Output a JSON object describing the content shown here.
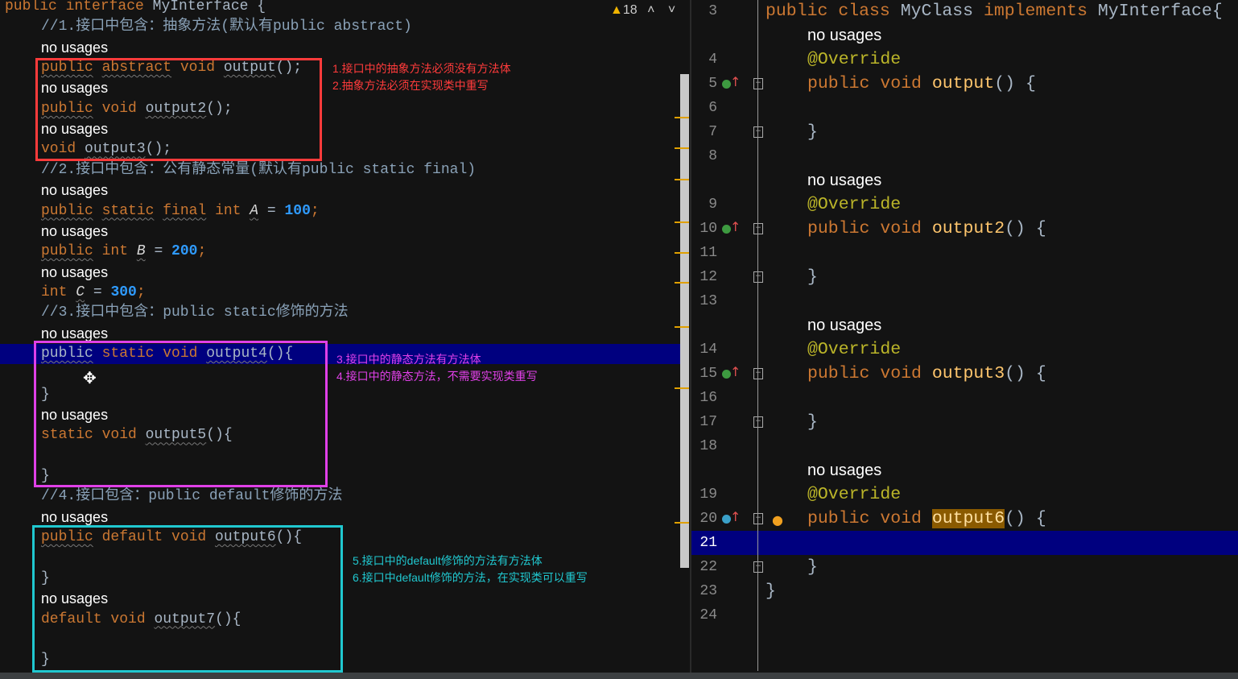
{
  "toolbar": {
    "warning_icon": "warning-triangle-icon",
    "warning_count": "18",
    "prev_icon": "chevron-up-icon",
    "next_icon": "chevron-down-icon"
  },
  "left_editor": {
    "rows": [
      {
        "top": true,
        "tokens": [
          {
            "t": "public ",
            "c": "kw"
          },
          {
            "t": "interface ",
            "c": "kw"
          },
          {
            "t": "MyInterface {",
            "c": "pl"
          }
        ]
      },
      {
        "tokens": [
          {
            "t": "//1.接口中包含：抽象方法(默认有public abstract)",
            "c": "cm"
          }
        ]
      },
      {
        "usage": "no usages"
      },
      {
        "tokens": [
          {
            "t": "public",
            "c": "kw ul"
          },
          {
            "t": " "
          },
          {
            "t": "abstract",
            "c": "kw ul"
          },
          {
            "t": " void ",
            "c": "kw"
          },
          {
            "t": "output",
            "c": "id ul"
          },
          {
            "t": "();",
            "c": "pl"
          }
        ]
      },
      {
        "usage": "no usages"
      },
      {
        "tokens": [
          {
            "t": "public",
            "c": "kw ul"
          },
          {
            "t": " void ",
            "c": "kw"
          },
          {
            "t": "output2",
            "c": "id ul"
          },
          {
            "t": "();",
            "c": "pl"
          }
        ]
      },
      {
        "usage": "no usages"
      },
      {
        "tokens": [
          {
            "t": "void ",
            "c": "kw"
          },
          {
            "t": "output3",
            "c": "id ul"
          },
          {
            "t": "();",
            "c": "pl"
          }
        ]
      },
      {
        "tokens": [
          {
            "t": "//2.接口中包含：公有静态常量(默认有public static final)",
            "c": "cm"
          }
        ]
      },
      {
        "usage": "no usages"
      },
      {
        "tokens": [
          {
            "t": "public",
            "c": "kw ul"
          },
          {
            "t": " "
          },
          {
            "t": "static",
            "c": "kw ul"
          },
          {
            "t": " "
          },
          {
            "t": "final",
            "c": "kw ul"
          },
          {
            "t": " int ",
            "c": "kw"
          },
          {
            "t": "A",
            "c": "cst ul"
          },
          {
            "t": " = ",
            "c": "pl"
          },
          {
            "t": "100",
            "c": "num"
          },
          {
            "t": ";",
            "c": "kw"
          }
        ]
      },
      {
        "usage": "no usages"
      },
      {
        "tokens": [
          {
            "t": "public",
            "c": "kw ul"
          },
          {
            "t": " int ",
            "c": "kw"
          },
          {
            "t": "B",
            "c": "cst ul"
          },
          {
            "t": " = ",
            "c": "pl"
          },
          {
            "t": "200",
            "c": "num"
          },
          {
            "t": ";",
            "c": "kw"
          }
        ]
      },
      {
        "usage": "no usages"
      },
      {
        "tokens": [
          {
            "t": "int ",
            "c": "kw"
          },
          {
            "t": "C",
            "c": "cst ul"
          },
          {
            "t": " = ",
            "c": "pl"
          },
          {
            "t": "300",
            "c": "num"
          },
          {
            "t": ";",
            "c": "kw"
          }
        ]
      },
      {
        "tokens": [
          {
            "t": "//3.接口中包含：public static修饰的方法",
            "c": "cm"
          }
        ]
      },
      {
        "usage": "no usages"
      },
      {
        "hl": true,
        "tokens": [
          {
            "t": "public",
            "c": "id ul"
          },
          {
            "t": " static void ",
            "c": "kw"
          },
          {
            "t": "output4",
            "c": "id ul"
          },
          {
            "t": "(){",
            "c": "pl"
          }
        ]
      },
      {
        "tokens": []
      },
      {
        "tokens": [
          {
            "t": "}",
            "c": "pl"
          }
        ]
      },
      {
        "usage": "no usages"
      },
      {
        "tokens": [
          {
            "t": "static void ",
            "c": "kw"
          },
          {
            "t": "output5",
            "c": "id ul"
          },
          {
            "t": "(){",
            "c": "pl"
          }
        ]
      },
      {
        "tokens": []
      },
      {
        "tokens": [
          {
            "t": "}",
            "c": "pl"
          }
        ]
      },
      {
        "tokens": [
          {
            "t": "//4.接口包含：public default修饰的方法",
            "c": "cm"
          }
        ]
      },
      {
        "usage": "no usages"
      },
      {
        "tokens": [
          {
            "t": "public",
            "c": "kw ul"
          },
          {
            "t": " default void ",
            "c": "kw"
          },
          {
            "t": "output6",
            "c": "id ul"
          },
          {
            "t": "(){",
            "c": "pl"
          }
        ]
      },
      {
        "tokens": []
      },
      {
        "tokens": [
          {
            "t": "}",
            "c": "pl"
          }
        ]
      },
      {
        "usage": "no usages"
      },
      {
        "tokens": [
          {
            "t": "default void ",
            "c": "kw"
          },
          {
            "t": "output7",
            "c": "id ul"
          },
          {
            "t": "(){",
            "c": "pl"
          }
        ]
      },
      {
        "tokens": []
      },
      {
        "tokens": [
          {
            "t": "}",
            "c": "pl"
          }
        ]
      }
    ]
  },
  "annotations": {
    "red": {
      "color": "#ff3b3b",
      "lines": [
        "1.接口中的抽象方法必须没有方法体",
        "2.抽象方法必须在实现类中重写"
      ]
    },
    "magenta": {
      "color": "#e040e8",
      "lines": [
        "3.接口中的静态方法有方法体",
        "4.接口中的静态方法，不需要实现类重写"
      ]
    },
    "cyan": {
      "color": "#20c8d0",
      "lines": [
        "5.接口中的default修饰的方法有方法体",
        "6.接口中default修饰的方法，在实现类可以重写"
      ]
    }
  },
  "right_editor": {
    "rows": [
      {
        "num": "3",
        "top": true,
        "tokens": [
          {
            "t": "public class ",
            "c": "kw"
          },
          {
            "t": "MyClass ",
            "c": "pl"
          },
          {
            "t": "implements ",
            "c": "kw"
          },
          {
            "t": "MyInterface{",
            "c": "pl"
          }
        ]
      },
      {
        "usage": "no usages"
      },
      {
        "num": "4",
        "tokens": [
          {
            "t": "@Override",
            "c": "ann"
          }
        ]
      },
      {
        "num": "5",
        "impl": "implements",
        "fold": "open",
        "tokens": [
          {
            "t": "public void ",
            "c": "kw"
          },
          {
            "t": "output",
            "c": "fn"
          },
          {
            "t": "() {",
            "c": "pl"
          }
        ]
      },
      {
        "num": "6",
        "tokens": []
      },
      {
        "num": "7",
        "fold": "close",
        "tokens": [
          {
            "t": "}",
            "c": "pl"
          }
        ]
      },
      {
        "num": "8",
        "tokens": []
      },
      {
        "usage": "no usages"
      },
      {
        "num": "9",
        "tokens": [
          {
            "t": "@Override",
            "c": "ann"
          }
        ]
      },
      {
        "num": "10",
        "impl": "implements",
        "fold": "open",
        "tokens": [
          {
            "t": "public void ",
            "c": "kw"
          },
          {
            "t": "output2",
            "c": "fn"
          },
          {
            "t": "() {",
            "c": "pl"
          }
        ]
      },
      {
        "num": "11",
        "tokens": []
      },
      {
        "num": "12",
        "fold": "close",
        "tokens": [
          {
            "t": "}",
            "c": "pl"
          }
        ]
      },
      {
        "num": "13",
        "tokens": []
      },
      {
        "usage": "no usages"
      },
      {
        "num": "14",
        "tokens": [
          {
            "t": "@Override",
            "c": "ann"
          }
        ]
      },
      {
        "num": "15",
        "impl": "implements",
        "fold": "open",
        "tokens": [
          {
            "t": "public void ",
            "c": "kw"
          },
          {
            "t": "output3",
            "c": "fn"
          },
          {
            "t": "() {",
            "c": "pl"
          }
        ]
      },
      {
        "num": "16",
        "tokens": []
      },
      {
        "num": "17",
        "fold": "close",
        "tokens": [
          {
            "t": "}",
            "c": "pl"
          }
        ]
      },
      {
        "num": "18",
        "tokens": []
      },
      {
        "usage": "no usages"
      },
      {
        "num": "19",
        "tokens": [
          {
            "t": "@Override",
            "c": "ann"
          }
        ]
      },
      {
        "num": "20",
        "impl": "overrides",
        "fold": "open",
        "bulb": true,
        "tokens": [
          {
            "t": "public void ",
            "c": "kw"
          },
          {
            "t": "output6",
            "c": "fn sel"
          },
          {
            "t": "() {",
            "c": "pl"
          }
        ]
      },
      {
        "num": "21",
        "hl": true,
        "cur": true,
        "tokens": []
      },
      {
        "num": "22",
        "fold": "close",
        "tokens": [
          {
            "t": "}",
            "c": "pl"
          }
        ]
      },
      {
        "num": "23",
        "top": true,
        "tokens": [
          {
            "t": "}",
            "c": "pl"
          }
        ]
      },
      {
        "num": "24",
        "tokens": []
      }
    ]
  }
}
